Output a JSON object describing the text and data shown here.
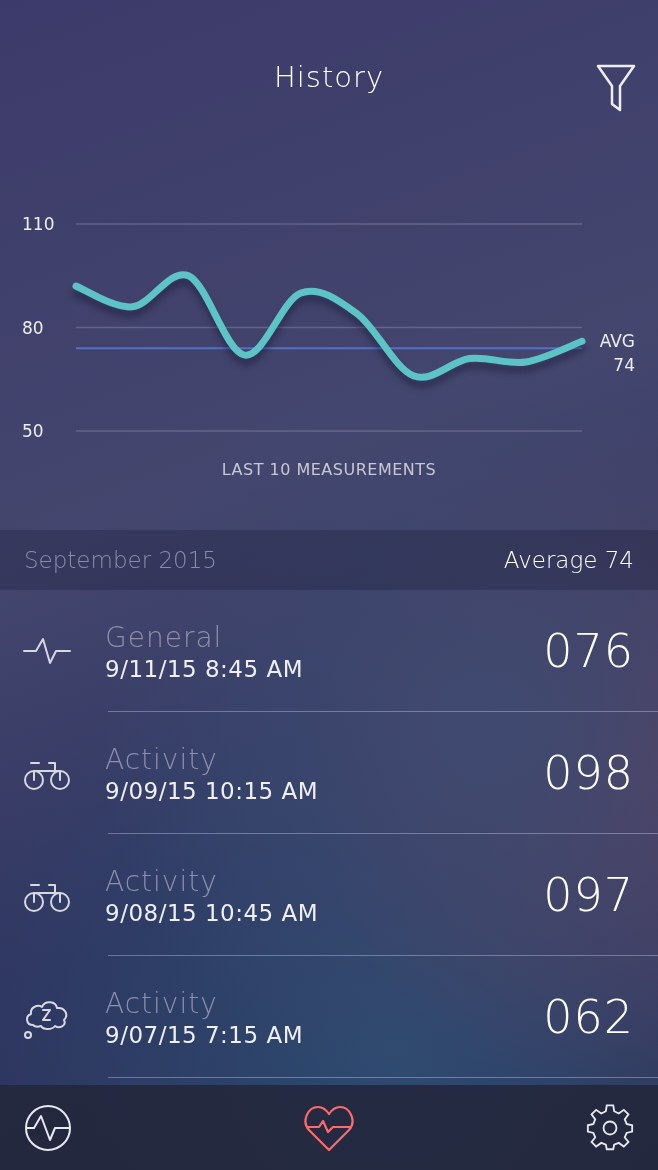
{
  "header": {
    "title": "History"
  },
  "chart": {
    "chart_data": {
      "type": "line",
      "xlabel": "LAST 10 MEASUREMENTS",
      "ylim": [
        50,
        110
      ],
      "yticks": [
        50,
        80,
        110
      ],
      "series": [
        {
          "name": "AVG",
          "color": "#5570c0",
          "values": [
            74,
            74,
            74,
            74,
            74,
            74,
            74,
            74,
            74,
            74
          ]
        },
        {
          "color": "#5cc3c6",
          "values": [
            92,
            86,
            95,
            72,
            90,
            84,
            66,
            71,
            70,
            76
          ]
        }
      ]
    },
    "average_value": "74"
  },
  "month_bar": {
    "month": "September 2015",
    "average": "Average 74"
  },
  "entries": [
    {
      "kind": "pulse",
      "category": "General",
      "timestamp": "9/11/15 8:45 AM",
      "value": "076"
    },
    {
      "kind": "bike",
      "category": "Activity",
      "timestamp": "9/09/15 10:15 AM",
      "value": "098"
    },
    {
      "kind": "bike",
      "category": "Activity",
      "timestamp": "9/08/15 10:45 AM",
      "value": "097"
    },
    {
      "kind": "sleep",
      "category": "Activity",
      "timestamp": "9/07/15 7:15 AM",
      "value": "062"
    }
  ],
  "bottom_nav": [
    {
      "selected": false
    },
    {
      "selected": true
    },
    {
      "selected": false
    }
  ]
}
